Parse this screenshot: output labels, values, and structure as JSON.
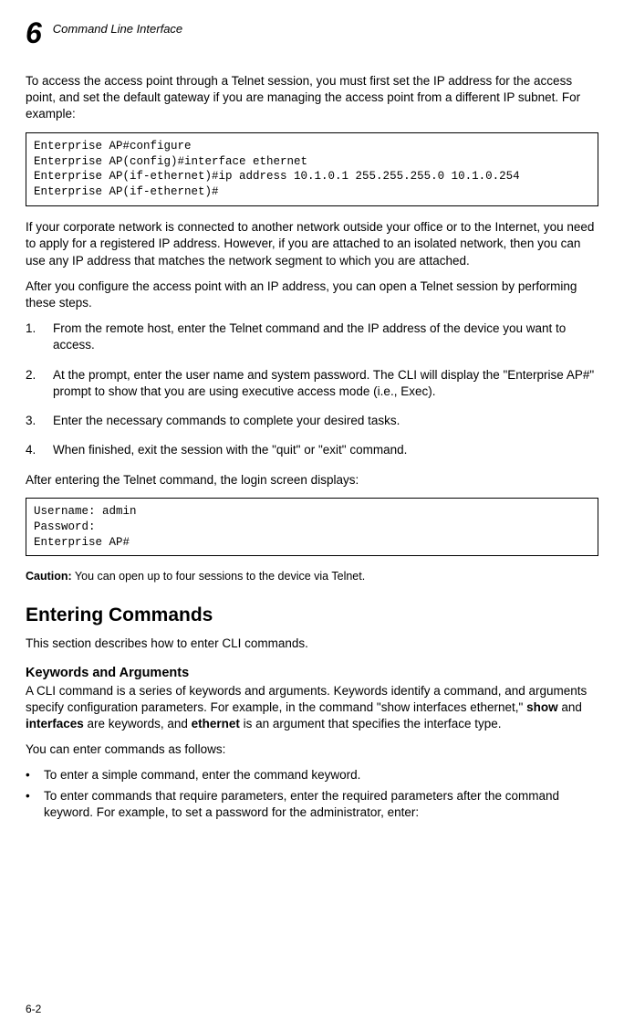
{
  "header": {
    "chapter_num": "6",
    "title": "Command Line Interface"
  },
  "para1": "To access the access point through a Telnet session, you must first set the IP address for the access point, and set the default gateway if you are managing the access point from a different IP subnet. For example:",
  "code1": "Enterprise AP#configure\nEnterprise AP(config)#interface ethernet\nEnterprise AP(if-ethernet)#ip address 10.1.0.1 255.255.255.0 10.1.0.254\nEnterprise AP(if-ethernet)#",
  "para2": "If your corporate network is connected to another network outside your office or to the Internet, you need to apply for a registered IP address. However, if you are attached to an isolated network, then you can use any IP address that matches the network segment to which you are attached.",
  "para3": "After you configure the access point with an IP address, you can open a Telnet session by performing these steps.",
  "steps": [
    "From the remote host, enter the Telnet command and the IP address of the device you want to access.",
    "At the prompt, enter the user name and system password. The CLI will display the \"Enterprise AP#\" prompt to show that you are using executive access mode (i.e., Exec).",
    "Enter the necessary commands to complete your desired tasks.",
    "When finished, exit the session with the \"quit\" or \"exit\" command."
  ],
  "para4": "After entering the Telnet command, the login screen displays:",
  "code2": "Username: admin\nPassword: \nEnterprise AP#",
  "caution": {
    "label": "Caution:",
    "text": "  You can open up to four sessions to the device via Telnet."
  },
  "h2": "Entering Commands",
  "para5": "This section describes how to enter CLI commands.",
  "h3": "Keywords and Arguments",
  "para6_pre": "A CLI command is a series of keywords and arguments. Keywords identify a command, and arguments specify configuration parameters. For example, in the command \"show interfaces ethernet,\" ",
  "para6_show": "show",
  "para6_mid1": " and ",
  "para6_interfaces": "interfaces",
  "para6_mid2": " are keywords, and ",
  "para6_ethernet": "ethernet",
  "para6_end": " is an argument that specifies the interface type.",
  "para7": "You can enter commands as follows:",
  "bullets": [
    "To enter a simple command, enter the command keyword.",
    "To enter commands that require parameters, enter the required parameters after the command keyword. For example, to set a password for the administrator, enter:"
  ],
  "page_num": "6-2"
}
